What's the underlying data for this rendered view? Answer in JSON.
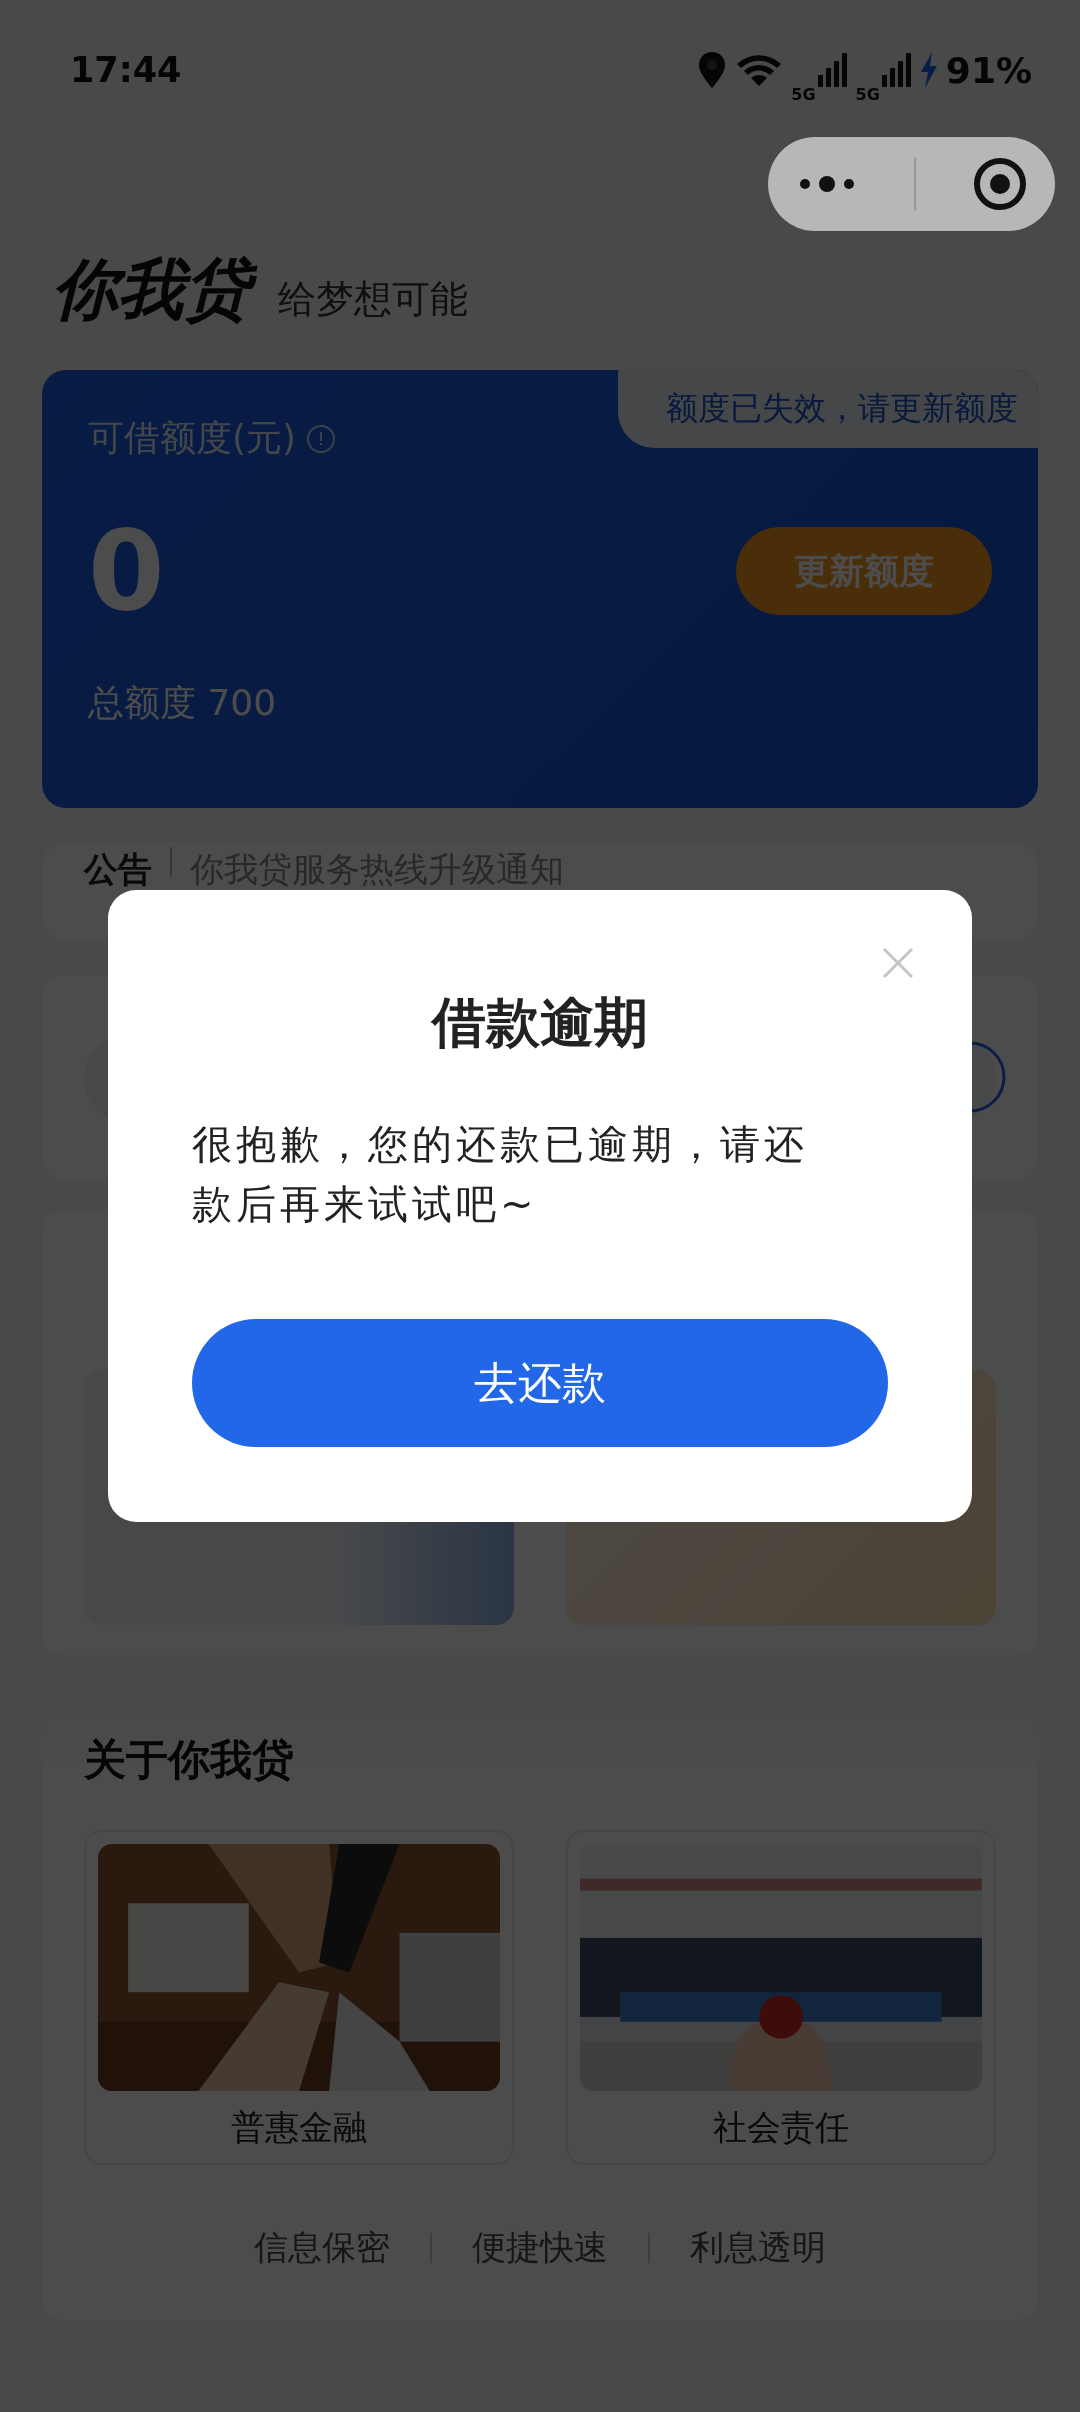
{
  "status_bar": {
    "time": "17:44",
    "network_1": "5G",
    "network_2": "5G",
    "battery": "91%"
  },
  "brand": {
    "logo": "你我贷",
    "slogan": "给梦想可能"
  },
  "credit_card": {
    "label": "可借额度(元)",
    "notice_tab": "额度已失效，请更新额度",
    "amount": "0",
    "button": "更新额度",
    "total": "总额度 700"
  },
  "announcement": {
    "tag": "公告",
    "text": "你我贷服务热线升级通知"
  },
  "about": {
    "title": "关于你我贷",
    "items": [
      {
        "label": "普惠金融",
        "kind": "picture"
      },
      {
        "label": "社会责任",
        "kind": "picture"
      }
    ],
    "features": [
      "信息保密",
      "便捷快速",
      "利息透明"
    ]
  },
  "dialog": {
    "title": "借款逾期",
    "message": "很抱歉，您的还款已逾期，请还款后再来试试吧~",
    "button": "去还款"
  }
}
